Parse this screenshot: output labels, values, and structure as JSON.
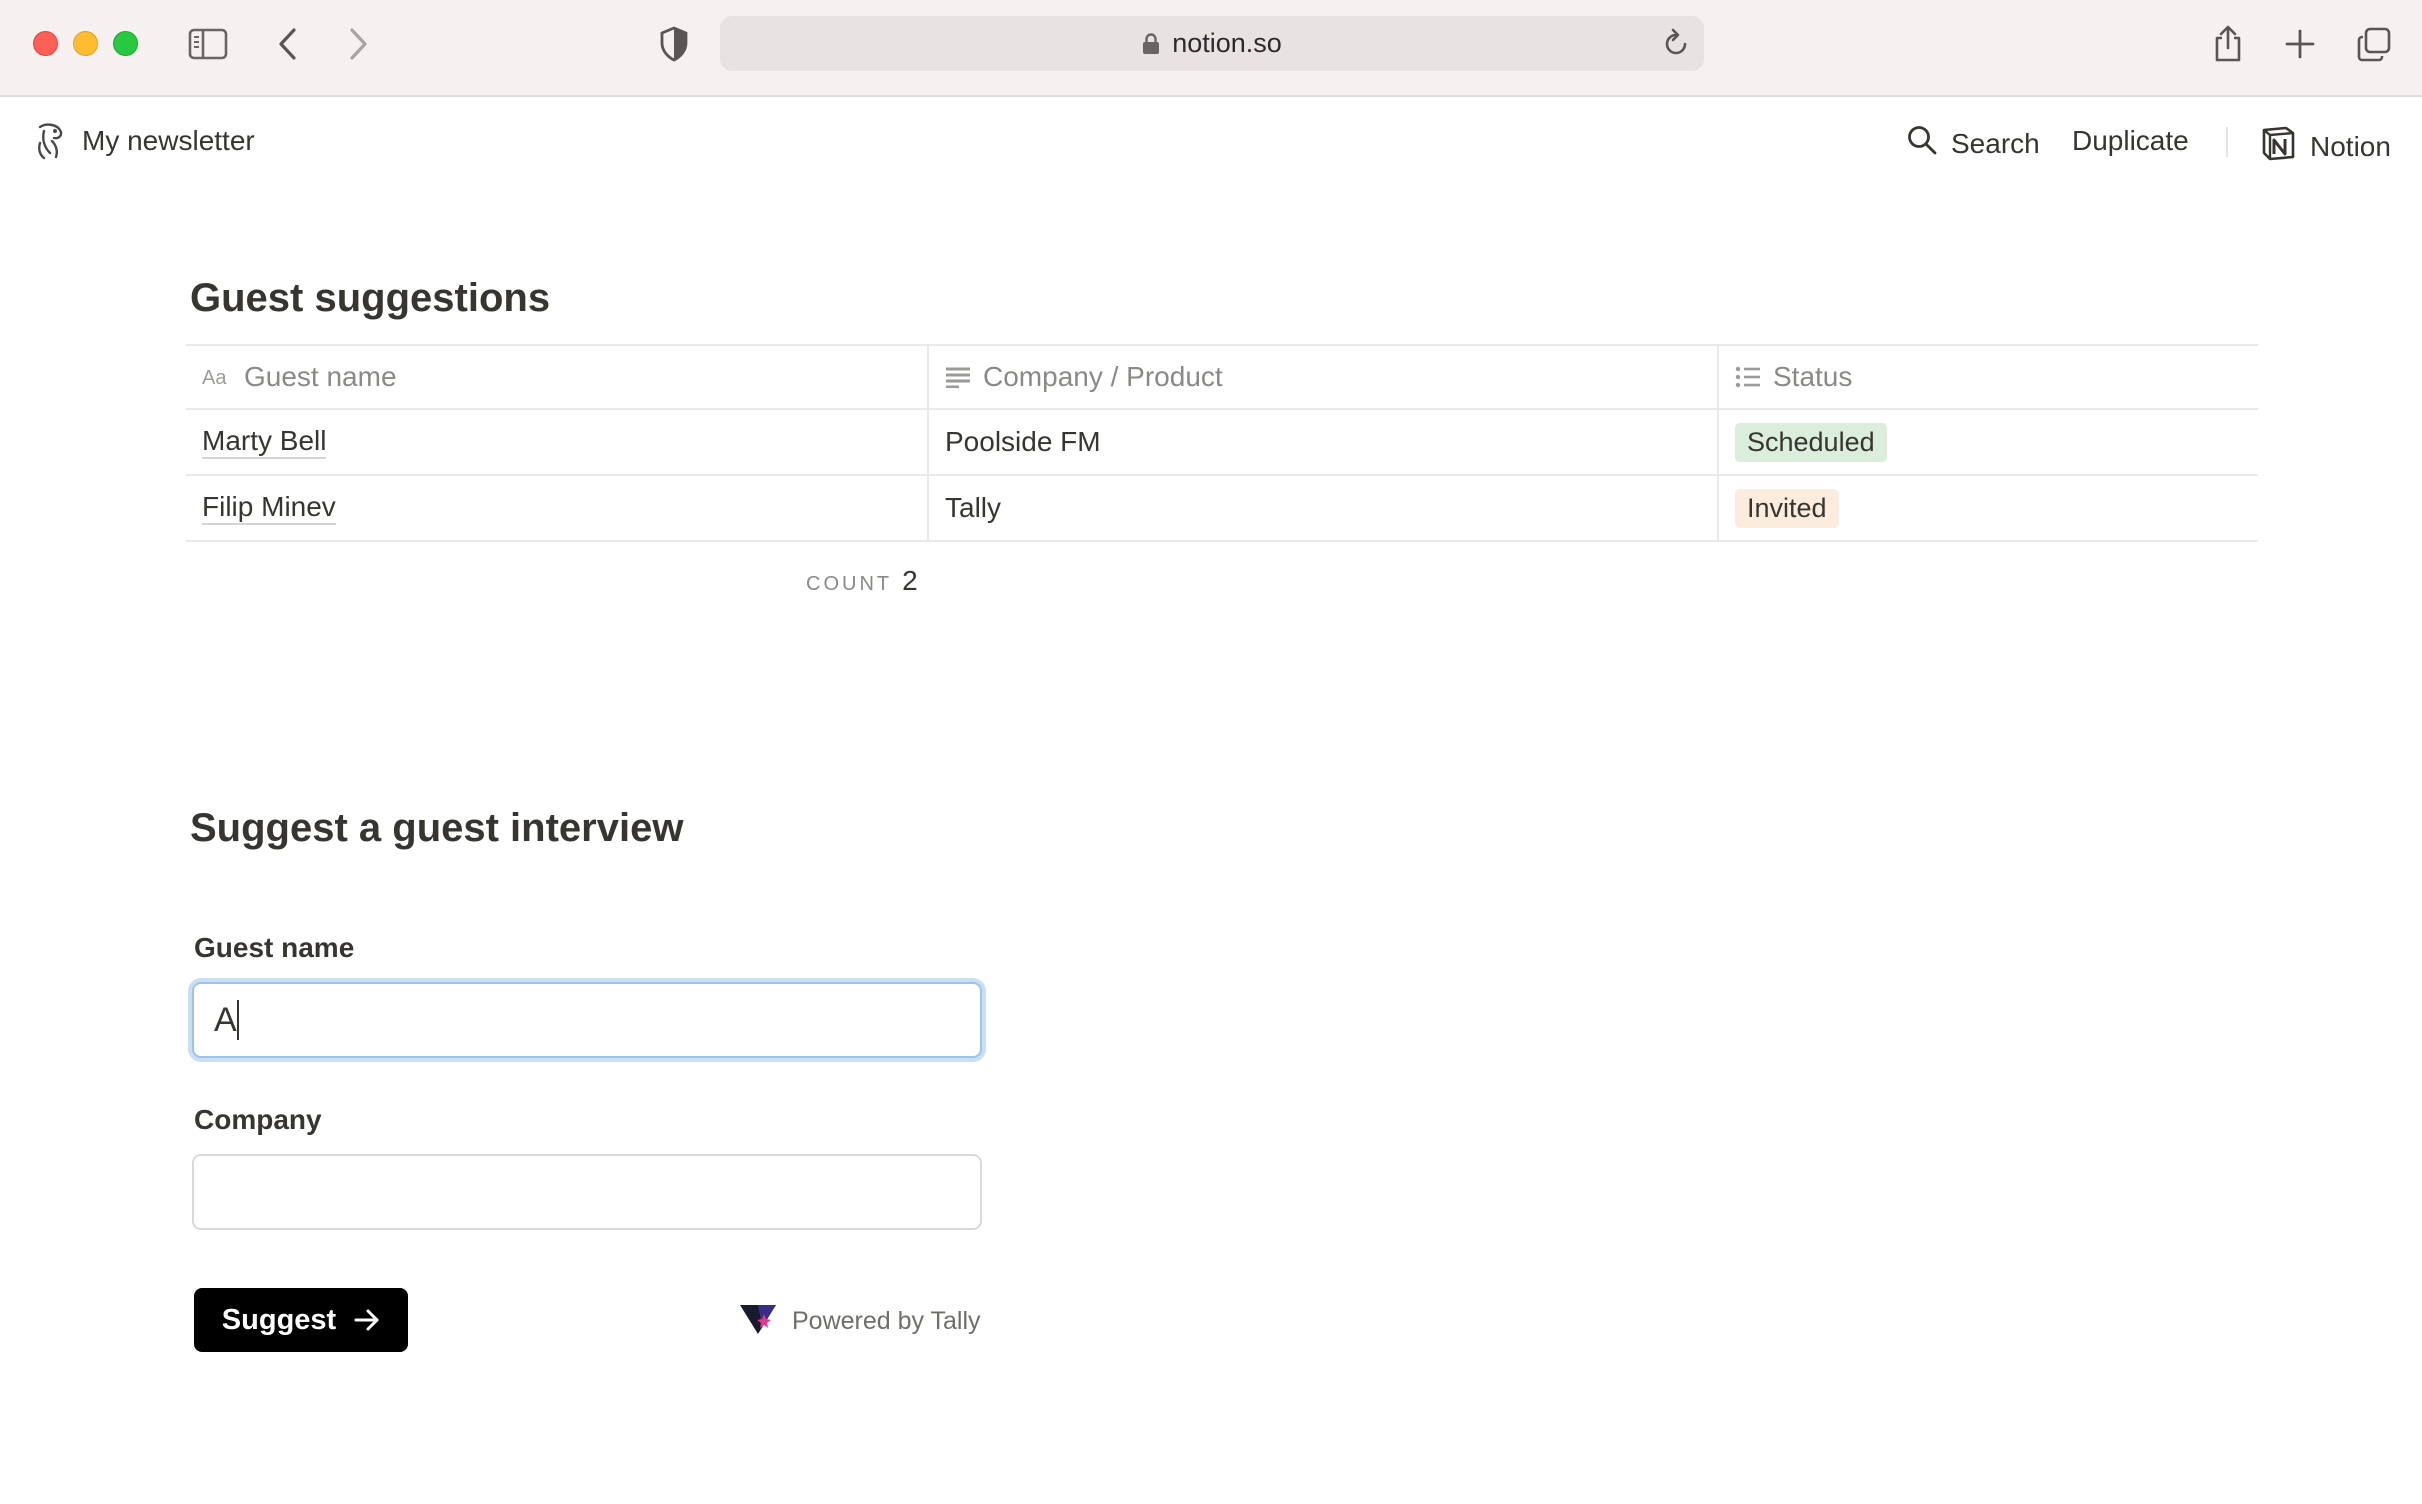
{
  "browser": {
    "url": "notion.so"
  },
  "topbar": {
    "page_title": "My newsletter",
    "search_label": "Search",
    "duplicate_label": "Duplicate",
    "notion_label": "Notion"
  },
  "database": {
    "title": "Guest suggestions",
    "columns": [
      {
        "label": "Guest name",
        "icon": "text-property-icon"
      },
      {
        "label": "Company / Product",
        "icon": "text-lines-icon"
      },
      {
        "label": "Status",
        "icon": "list-icon"
      }
    ],
    "rows": [
      {
        "name": "Marty Bell",
        "company": "Poolside FM",
        "status": "Scheduled",
        "status_color": "#dbeddb"
      },
      {
        "name": "Filip Minev",
        "company": "Tally",
        "status": "Invited",
        "status_color": "#fbecdd"
      }
    ],
    "count_label": "COUNT",
    "count_value": "2"
  },
  "form": {
    "title": "Suggest a guest interview",
    "guest_name_label": "Guest name",
    "guest_name_value": "A",
    "company_label": "Company",
    "company_value": "",
    "submit_label": "Suggest",
    "powered_by": "Powered by Tally"
  }
}
